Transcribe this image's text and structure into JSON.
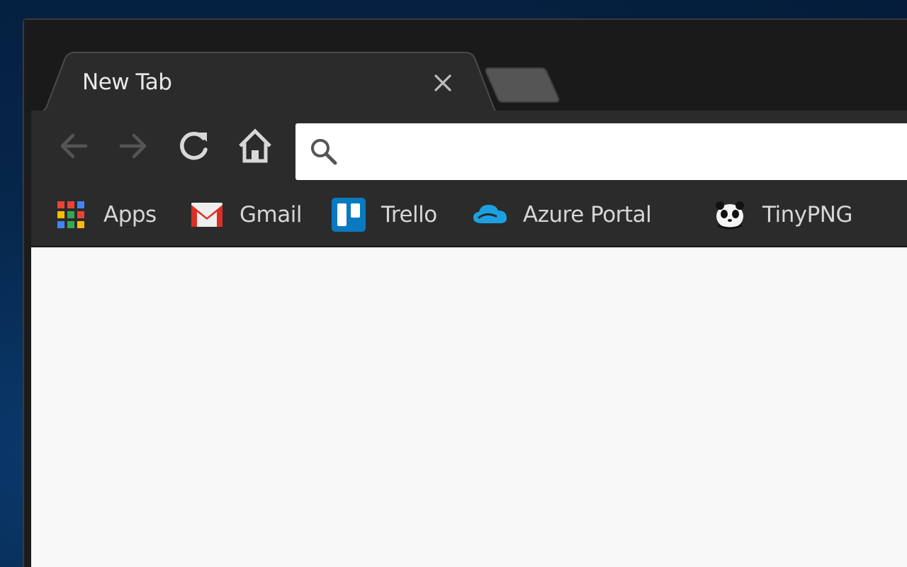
{
  "tabs": [
    {
      "title": "New Tab",
      "active": true
    }
  ],
  "toolbar": {
    "back_icon": "arrow-left-icon",
    "forward_icon": "arrow-right-icon",
    "reload_icon": "reload-icon",
    "home_icon": "home-icon"
  },
  "omnibox": {
    "value": "",
    "icon": "search-icon"
  },
  "bookmarks": [
    {
      "label": "Apps",
      "icon": "apps-grid-icon"
    },
    {
      "label": "Gmail",
      "icon": "gmail-icon"
    },
    {
      "label": "Trello",
      "icon": "trello-icon"
    },
    {
      "label": "Azure Portal",
      "icon": "azure-cloud-icon"
    },
    {
      "label": "TinyPNG",
      "icon": "tinypng-panda-icon"
    }
  ],
  "colors": {
    "window_frame": "#1c1c1c",
    "toolbar": "#2b2b2b",
    "content_bg": "#f8f8f8",
    "gmail_red": "#d93025",
    "trello_blue": "#0a79bf",
    "azure_blue": "#1ba1e2"
  }
}
